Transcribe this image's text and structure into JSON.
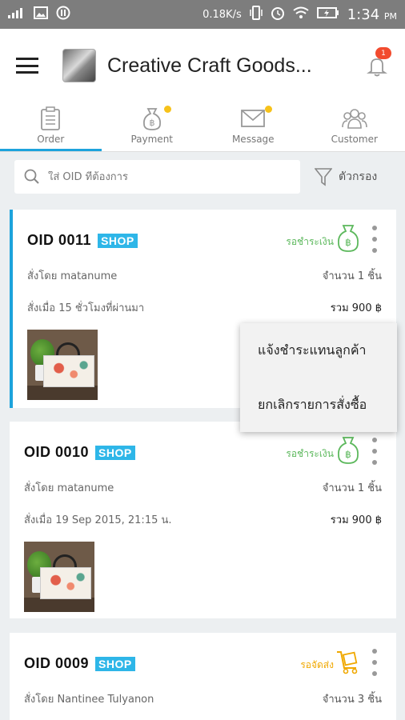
{
  "status_bar": {
    "net_speed": "0.18K/s",
    "time": "1:34",
    "ampm": "PM"
  },
  "header": {
    "title": "Creative Craft Goods...",
    "notification_count": "1"
  },
  "tabs": [
    {
      "label": "Order",
      "active": true,
      "dot": false
    },
    {
      "label": "Payment",
      "active": false,
      "dot": true
    },
    {
      "label": "Message",
      "active": false,
      "dot": true
    },
    {
      "label": "Customer",
      "active": false,
      "dot": false
    }
  ],
  "search": {
    "placeholder": "ใส่ OID ที่ต้องการ",
    "filter_label": "ตัวกรอง"
  },
  "orders": [
    {
      "oid": "OID 0011",
      "badge": "SHOP",
      "status": "รอชำระเงิน",
      "status_color": "#5cb85c",
      "ordered_by": "สั่งโดย  matanume",
      "quantity": "จำนวน 1 ชิ้น",
      "ordered_when": "สั่งเมื่อ 15 ชั่วโมงที่ผ่านมา",
      "total": "รวม 900 ฿"
    },
    {
      "oid": "OID 0010",
      "badge": "SHOP",
      "status": "รอชำระเงิน",
      "status_color": "#5cb85c",
      "ordered_by": "สั่งโดย  matanume",
      "quantity": "จำนวน 1 ชิ้น",
      "ordered_when": "สั่งเมื่อ 19 Sep 2015, 21:15 น.",
      "total": "รวม 900 ฿"
    },
    {
      "oid": "OID 0009",
      "badge": "SHOP",
      "status": "รอจัดส่ง",
      "status_color": "#f0a800",
      "ordered_by": "สั่งโดย  Nantinee Tulyanon",
      "quantity": "จำนวน 3 ชิ้น"
    }
  ],
  "context_menu": {
    "items": [
      "แจ้งชำระแทนลูกค้า",
      "ยกเลิกรายการสั่งซื้อ"
    ]
  },
  "colors": {
    "accent": "#1da3dc",
    "badge": "#2eb6e8",
    "notification": "#f24b2e",
    "tab_dot": "#f7c21a"
  }
}
